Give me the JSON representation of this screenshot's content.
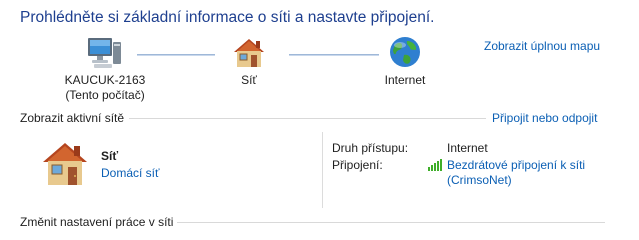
{
  "header": {
    "title": "Prohlédněte si základní informace o síti a nastavte připojení.",
    "full_map_link": "Zobrazit úplnou mapu"
  },
  "map": {
    "computer": {
      "name": "KAUCUK-2163",
      "subtitle": "(Tento počítač)",
      "icon": "computer-icon"
    },
    "network": {
      "name": "Síť",
      "icon": "house-icon"
    },
    "internet": {
      "name": "Internet",
      "icon": "globe-icon"
    }
  },
  "active_networks": {
    "heading": "Zobrazit aktivní sítě",
    "connect_link": "Připojit nebo odpojit",
    "network_name": "Síť",
    "network_type": "Domácí síť",
    "access_type_label": "Druh přístupu:",
    "access_type_value": "Internet",
    "connections_label": "Připojení:",
    "connection_name_line1": "Bezdrátové připojení k síti",
    "connection_name_line2": "(CrimsoNet)"
  },
  "change_settings": {
    "heading": "Změnit nastavení práce v síti"
  },
  "colors": {
    "title": "#1e3f8f",
    "link": "#0b5fb4",
    "signal": "#3fae2a"
  }
}
